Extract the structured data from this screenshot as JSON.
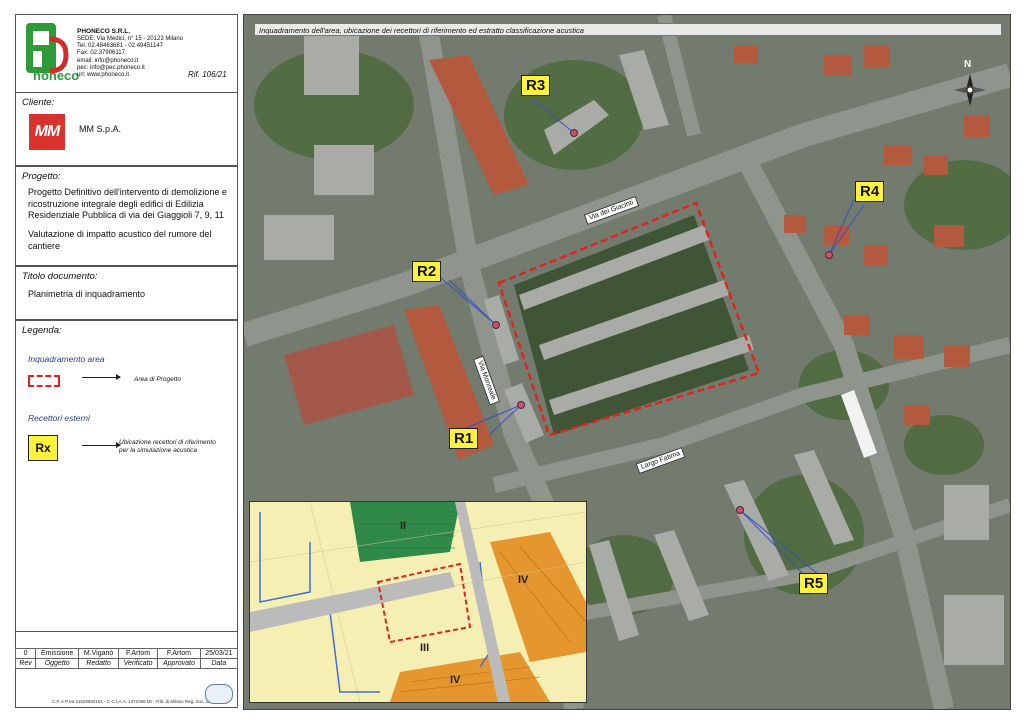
{
  "company": {
    "name": "PHONECO S.R.L.",
    "logo_text": "honeco",
    "lines": [
      "SEDE: Via Medici, n° 15 - 20123 Milano",
      "Tel. 02.48463681 - 02.49451147",
      "Fax: 02.37906117",
      "email: info@phoneco.it",
      "pec: info@pec.phoneco.it",
      "url: www.phoneco.it"
    ],
    "ref": "Rif. 106/21"
  },
  "client": {
    "heading": "Cliente:",
    "logo": "MM",
    "name": "MM S.p.A."
  },
  "project": {
    "heading": "Progetto:",
    "desc": "Progetto Definitivo dell'intervento di demolizione e ricostruzione integrale degli edifici di Edilizia Residenziale Pubblica di via dei Giaggioli 7, 9, 11",
    "sub": "Valutazione di impatto acustico del rumore del cantiere"
  },
  "doc_title": {
    "heading": "Titolo documento:",
    "value": "Planimetria di inquadramento"
  },
  "legend": {
    "heading": "Legenda:",
    "area_title": "Inquadramento area",
    "area_desc": "Area di Progetto",
    "rec_title": "Recettori esterni",
    "rec_symbol": "Rx",
    "rec_desc1": "Ubicazione recettori di riferimento",
    "rec_desc2": "per la simulazione acustica"
  },
  "revision": {
    "row": [
      "0",
      "Emissione",
      "M.Viganò",
      "F.Artom",
      "F.Artom",
      "25/03/21"
    ],
    "headers": [
      "Rev",
      "Oggetto",
      "Redatto",
      "Verificato",
      "Approvato",
      "Data"
    ]
  },
  "footer": {
    "text": "C.F. e P.iva 11529650151 - C.C.I.A.A. 1472366 Mi - Trib. di Milano Reg. Soc. 204080"
  },
  "map": {
    "title": "Inquadramento dell'area, ubicazione dei recettori di riferimento ed estratto classificazione acustica",
    "north": "N",
    "receptors": [
      "R1",
      "R2",
      "R3",
      "R4",
      "R5"
    ],
    "streets": [
      "Via dei Giacinti",
      "Via Monreale",
      "Largo Fatima"
    ],
    "zones": [
      "II",
      "III",
      "IV",
      "IV"
    ]
  },
  "colors": {
    "logo_green": "#2e9a3a",
    "logo_red": "#d42a2a",
    "client_red": "#d9332e",
    "receptor_yellow": "#fff23a",
    "project_border": "#e0231c"
  }
}
